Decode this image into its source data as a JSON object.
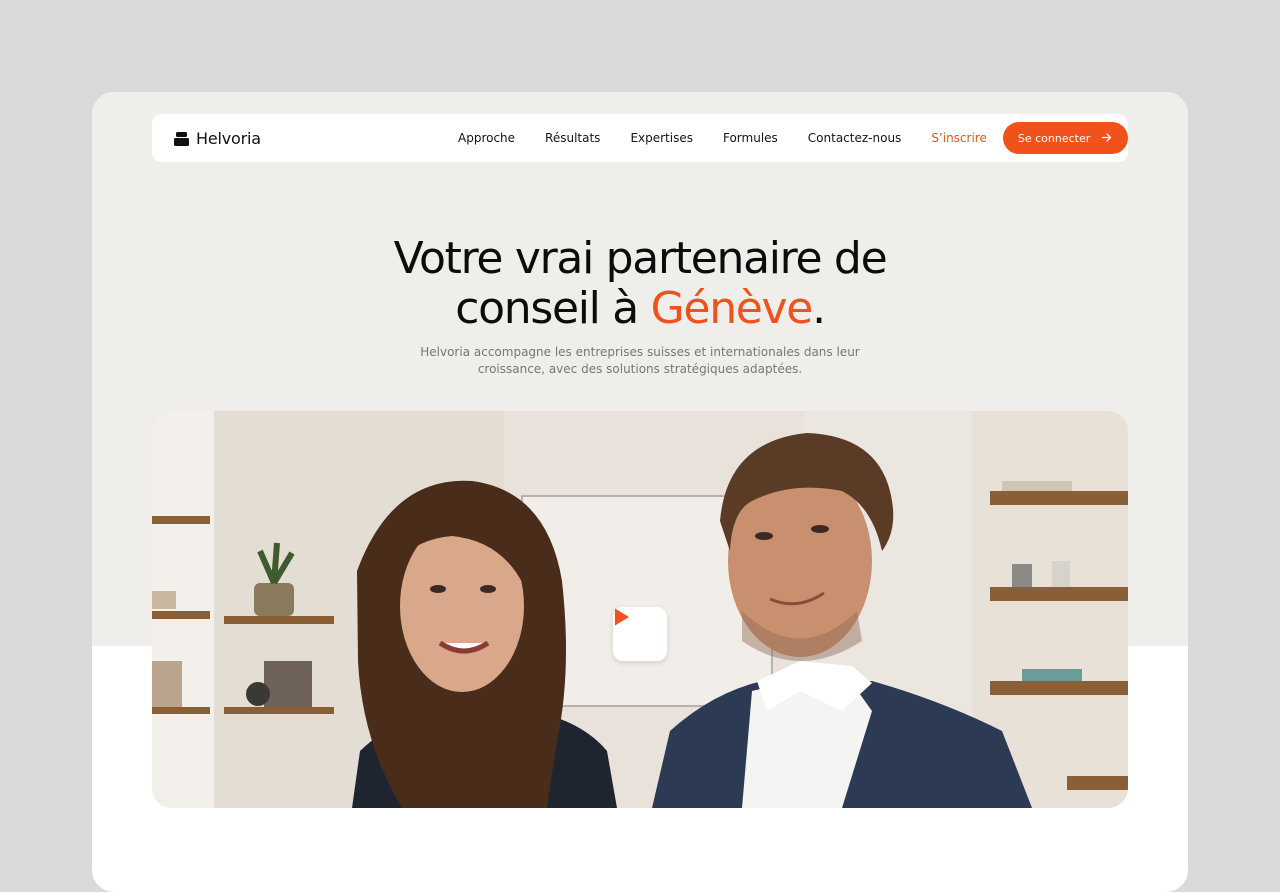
{
  "brand": {
    "name": "Helvoria",
    "icon": "briefcase-icon"
  },
  "nav": {
    "links": [
      "Approche",
      "Résultats",
      "Expertises",
      "Formules",
      "Contactez-nous"
    ],
    "signup_label": "S’inscrire",
    "login_label": "Se connecter",
    "login_icon": "arrow-right-icon"
  },
  "hero": {
    "headline_line1": "Votre vrai partenaire de",
    "headline_line2_prefix": "conseil à ",
    "headline_accent": "Génève",
    "headline_suffix": ".",
    "subtitle": "Helvoria accompagne les entreprises suisses et internationales dans leur croissance, avec des solutions stratégiques adaptées."
  },
  "media": {
    "play_icon": "play-icon"
  },
  "colors": {
    "accent": "#f1511b",
    "hero_background": "#efeeea",
    "page_background": "#d9d9d9"
  }
}
